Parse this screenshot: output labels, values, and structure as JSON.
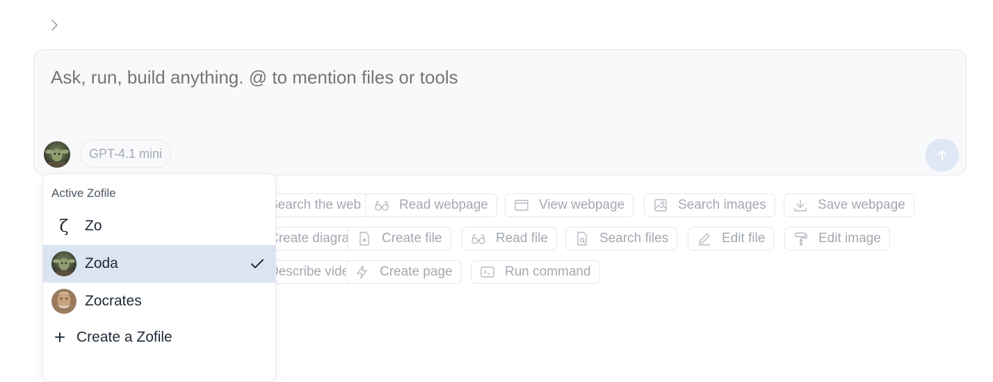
{
  "composer": {
    "placeholder": "Ask, run, build anything. @ to mention files or tools",
    "model_label": "GPT-4.1 mini"
  },
  "tools": [
    {
      "label": "Search the web",
      "icon": "globe-icon"
    },
    {
      "label": "Read webpage",
      "icon": "glasses-icon"
    },
    {
      "label": "View webpage",
      "icon": "browser-window-icon"
    },
    {
      "label": "Search images",
      "icon": "image-search-icon"
    },
    {
      "label": "Save webpage",
      "icon": "download-icon"
    },
    {
      "label": "Create diagram",
      "icon": "diagram-icon"
    },
    {
      "label": "Create file",
      "icon": "file-plus-icon"
    },
    {
      "label": "Read file",
      "icon": "glasses-icon"
    },
    {
      "label": "Search files",
      "icon": "file-search-icon"
    },
    {
      "label": "Edit file",
      "icon": "pencil-icon"
    },
    {
      "label": "Edit image",
      "icon": "paint-roller-icon"
    },
    {
      "label": "Describe video",
      "icon": "video-icon"
    },
    {
      "label": "Create page",
      "icon": "lightning-icon"
    },
    {
      "label": "Run command",
      "icon": "terminal-icon"
    }
  ],
  "zofile_menu": {
    "title": "Active Zofile",
    "items": [
      {
        "label": "Zo",
        "glyph": "ζ",
        "selected": false
      },
      {
        "label": "Zoda",
        "selected": true
      },
      {
        "label": "Zocrates",
        "selected": false
      }
    ],
    "create_label": "Create a Zofile",
    "create_glyph": "+"
  },
  "colors": {
    "composer_bg": "#f8f9fb",
    "selected_bg": "#dbe4f2",
    "send_button_bg": "#dfe7f6",
    "muted_text": "#a3a8b0"
  }
}
